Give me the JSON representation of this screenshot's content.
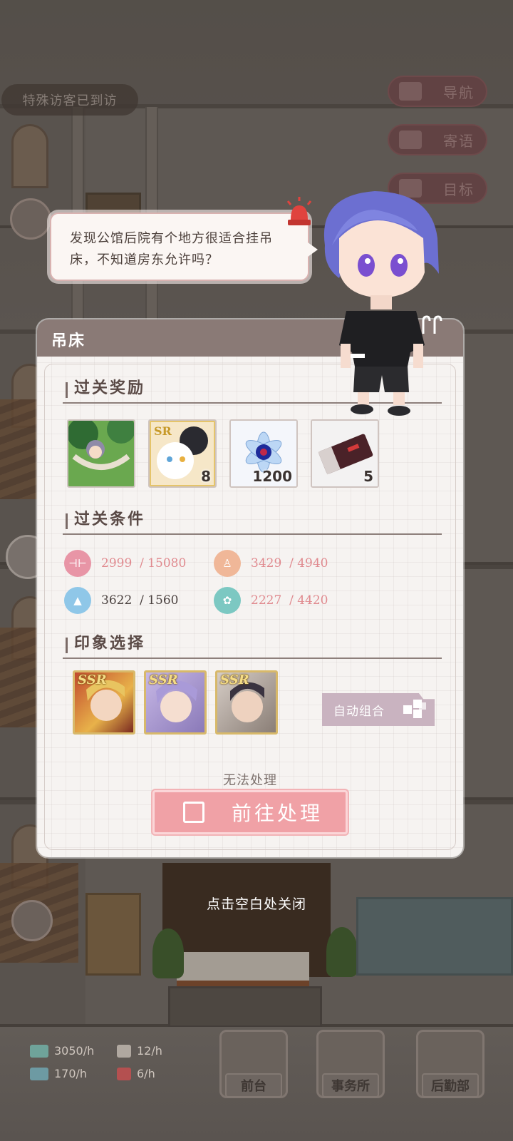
{
  "toast": "特殊访客已到访",
  "nav": [
    {
      "label": "导航",
      "icon": "map-icon"
    },
    {
      "label": "寄语",
      "icon": "letter-icon"
    },
    {
      "label": "目标",
      "icon": "flag-icon"
    }
  ],
  "bubble": {
    "text": "发现公馆后院有个地方很适合挂吊床，不知道房东允许吗？"
  },
  "panel": {
    "title": "吊床",
    "rewards_title": "过关奖励",
    "rewards": [
      {
        "name": "hammock-scene-card",
        "count": ""
      },
      {
        "name": "sr-cat-card",
        "count": "8"
      },
      {
        "name": "crystal-flower-item",
        "count": "1200"
      },
      {
        "name": "red-ticket-item",
        "count": "5"
      }
    ],
    "conditions_title": "过关条件",
    "conditions": [
      {
        "current": "2999",
        "required": "/ 15080",
        "icon": "dumbbell-icon",
        "color": "#e895a6",
        "met": false
      },
      {
        "current": "3429",
        "required": "/ 4940",
        "icon": "person-icon",
        "color": "#f0b798",
        "met": false
      },
      {
        "current": "3622",
        "required": "/ 1560",
        "icon": "graduation-cap-icon",
        "color": "#8fc7e8",
        "met": true
      },
      {
        "current": "2227",
        "required": "/ 4420",
        "icon": "flower-icon",
        "color": "#7cc8c2",
        "met": false
      }
    ],
    "impression_title": "印象选择",
    "cards": [
      {
        "rarity": "SSR",
        "name": "blonde-character-card"
      },
      {
        "rarity": "SSR",
        "name": "lavender-hair-character-card"
      },
      {
        "rarity": "SSR",
        "name": "dark-hair-character-card"
      }
    ],
    "auto_button": "自动组合",
    "status": "无法处理",
    "go_button": "前往处理"
  },
  "close_hint": "点击空白处关闭",
  "resources": [
    {
      "value": "3050/h",
      "icon": "money-icon"
    },
    {
      "value": "12/h",
      "icon": "chef-icon"
    },
    {
      "value": "170/h",
      "icon": "book-icon"
    },
    {
      "value": "6/h",
      "icon": "gift-icon"
    }
  ],
  "tabs": [
    "前台",
    "事务所",
    "后勤部"
  ],
  "colors": {
    "accent_pink": "#f0a1a6",
    "header": "#8a7a76"
  }
}
